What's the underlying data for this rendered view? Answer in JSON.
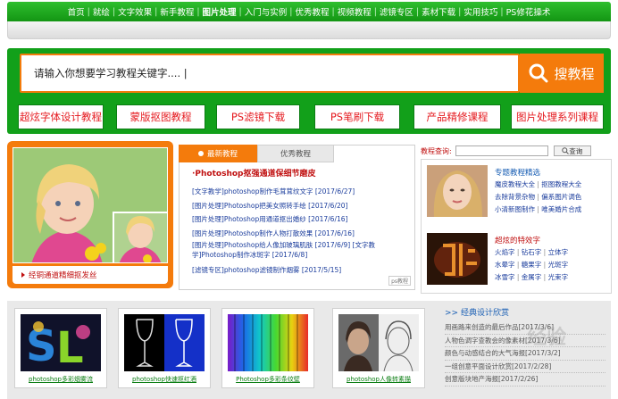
{
  "nav": {
    "items": [
      {
        "label": "首页",
        "bold": false
      },
      {
        "label": "就绘",
        "bold": false
      },
      {
        "label": "文字效果",
        "bold": false
      },
      {
        "label": "新手教程",
        "bold": false
      },
      {
        "label": "图片处理",
        "bold": true
      },
      {
        "label": "入门与实例",
        "bold": false
      },
      {
        "label": "优秀教程",
        "bold": false
      },
      {
        "label": "视频教程",
        "bold": false
      },
      {
        "label": "滤镜专区",
        "bold": false
      },
      {
        "label": "素材下载",
        "bold": false
      },
      {
        "label": "实用技巧",
        "bold": false
      },
      {
        "label": "PS修花操术",
        "bold": false
      }
    ],
    "separator": "|"
  },
  "search": {
    "value": "请输入你想要学习教程关键字.... |",
    "button_label": "搜教程"
  },
  "quick_links": [
    "超炫字体设计教程",
    "蒙版抠图教程",
    "PS滤镜下载",
    "PS笔刷下载",
    "产品精修课程",
    "图片处理系列课程"
  ],
  "photo_panel": {
    "caption": "经铜通道精细抠发丝"
  },
  "tutorials": {
    "tab_active": "最新教程",
    "tab_inactive": "优秀教程",
    "headline": "·Photoshop抠强通道保细节磨皮",
    "items": [
      "[文字教学]photoshop制作毛茸茸纹文字 [2017/6/27]",
      "[图片处理]Photoshop把美女照转手绘 [2017/6/20]",
      "[图片处理]Photoshop用通道抠出婚纱 [2017/6/16]",
      "[图片处理]Photoshop制作人物打散效果 [2017/6/16]",
      "[图片处理]Photoshop给人像加玻璃肌肤 [2017/6/9] [文字教学]Photoshop制作冰斑字 [2017/6/8]",
      "[滤镜专区]photoshop滤镜制作烟雾 [2017/5/15]"
    ],
    "more_tag": "ps教程"
  },
  "query": {
    "label": "教程查询:",
    "button_label": "查询"
  },
  "right_panel": {
    "section1_title": "专题教程精选",
    "section1_links": [
      [
        "魔皮教程大全",
        "抠图教程大全"
      ],
      [
        "去除背景杂物",
        "偏系图片调色"
      ],
      [
        "小清新图制作",
        "唯美婚片合成"
      ]
    ],
    "section2_title": "超炫的特效字",
    "section2_links": [
      [
        "火焰字",
        "钻石字",
        "立体字"
      ],
      [
        "水晕字",
        "糖果字",
        "光斑字"
      ],
      [
        "冰雪字",
        "金属字",
        "光束字"
      ]
    ]
  },
  "showcase": [
    {
      "caption": "photoshop多彩烟雾流"
    },
    {
      "caption": "photoshop快速抠红酒"
    },
    {
      "caption": "Photoshop多彩条纹壁"
    },
    {
      "caption": "photoshop人像转素描"
    }
  ],
  "classic": {
    "heading": ">> 经典设计欣赏",
    "items": [
      "用画路来创造的最后作品[2017/3/6]",
      "人物色调字查教会的像素材[2017/3/6]",
      "颜色与动感结合的大气海报[2017/3/2]",
      "一组创意平面设计欣赏[2017/2/28]",
      "创意版块地产海报[2017/2/26]"
    ]
  },
  "watermark": "经验"
}
